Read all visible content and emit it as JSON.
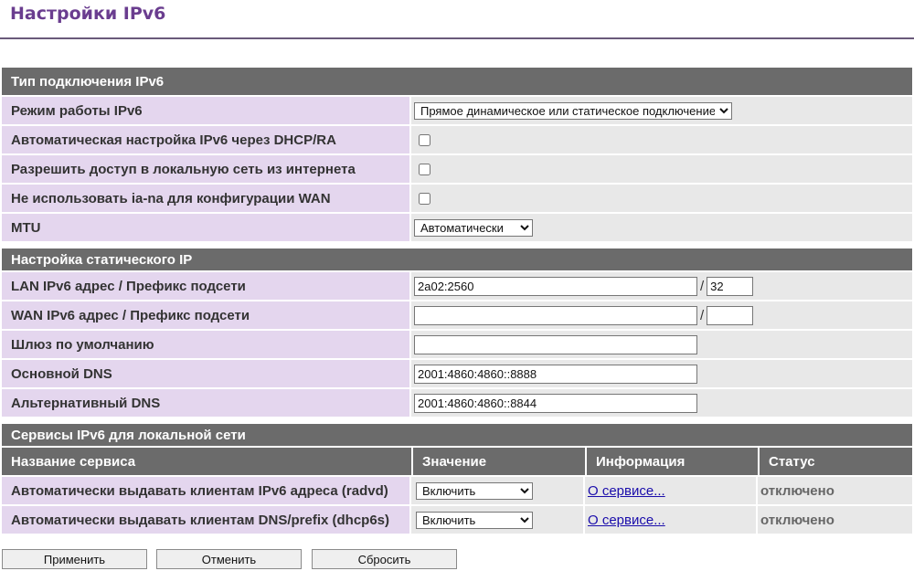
{
  "page": {
    "title": "Настройки IPv6"
  },
  "connection": {
    "header": "Тип подключения IPv6",
    "mode_label": "Режим работы IPv6",
    "mode_value": "Прямое динамическое или статическое подключение",
    "auto_dhcp_label": "Автоматическая настройка IPv6 через DHCP/RA",
    "auto_dhcp_checked": false,
    "allow_access_label": "Разрешить доступ в локальную сеть из интернета",
    "allow_access_checked": false,
    "no_iana_label": "Не использовать ia-na для конфигурации WAN",
    "no_iana_checked": false,
    "mtu_label": "MTU",
    "mtu_value": "Автоматически"
  },
  "static": {
    "header": "Настройка статического IP",
    "lan_label": "LAN IPv6 адрес / Префикс подсети",
    "lan_address": "2a02:2560",
    "lan_prefix": "32",
    "wan_label": "WAN IPv6 адрес / Префикс подсети",
    "wan_address": "",
    "wan_prefix": "",
    "gateway_label": "Шлюз по умолчанию",
    "gateway_value": "",
    "dns1_label": "Основной DNS",
    "dns1_value": "2001:4860:4860::8888",
    "dns2_label": "Альтернативный DNS",
    "dns2_value": "2001:4860:4860::8844",
    "separator": "/"
  },
  "services": {
    "header": "Сервисы IPv6 для локальной сети",
    "columns": [
      "Название сервиса",
      "Значение",
      "Информация",
      "Статус"
    ],
    "rows": [
      {
        "name": "Автоматически выдавать клиентам IPv6 адреса (radvd)",
        "value": "Включить",
        "info": "О сервисе...",
        "status": "отключено"
      },
      {
        "name": "Автоматически выдавать клиентам DNS/prefix (dhcp6s)",
        "value": "Включить",
        "info": "О сервисе...",
        "status": "отключено"
      }
    ]
  },
  "buttons": {
    "apply": "Применить",
    "cancel": "Отменить",
    "reset": "Сбросить"
  },
  "colors": {
    "title": "#6a3d8f",
    "section_header": "#6b6b6b",
    "label_bg": "#e4d6ee",
    "value_bg": "#e8e8e8",
    "link": "#1a0dab"
  }
}
